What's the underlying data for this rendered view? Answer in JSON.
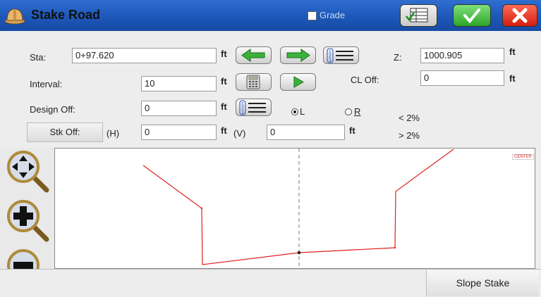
{
  "app": {
    "title": "Stake Road",
    "grade_label": "Grade",
    "grade_checked": false
  },
  "toolbar": {
    "table_icon": "table-icon",
    "ok_icon": "checkmark-icon",
    "close_icon": "close-x-icon"
  },
  "form": {
    "sta": {
      "label": "Sta:",
      "value": "0+97.620",
      "unit": "ft"
    },
    "interval": {
      "label": "Interval:",
      "value": "10",
      "unit": "ft"
    },
    "design_off": {
      "label": "Design Off:",
      "value": "0",
      "unit": "ft"
    },
    "stk_off": {
      "label": "Stk Off:",
      "h_label": "(H)",
      "h_value": "0",
      "h_unit": "ft",
      "v_label": "(V)",
      "v_value": "0",
      "v_unit": "ft"
    },
    "z": {
      "label": "Z:",
      "value": "1000.905",
      "unit": "ft"
    },
    "cl_off": {
      "label": "CL Off:",
      "value": "0",
      "unit": "ft"
    },
    "side_left": {
      "label": "L",
      "selected": true
    },
    "side_right": {
      "label": "R",
      "selected": false
    },
    "slope_lt": "< 2%",
    "slope_gt": "> 2%"
  },
  "canvas": {
    "center_tag": "CENTER"
  },
  "zoom_buttons": [
    "zoom-pan-icon",
    "zoom-in-icon",
    "zoom-out-icon"
  ],
  "footer": {
    "slope_stake_label": "Slope Stake"
  },
  "colors": {
    "titlebar": "#1d57b8",
    "profile_line": "#e02020",
    "ok": "#2fa52a",
    "close": "#d41d0f"
  }
}
